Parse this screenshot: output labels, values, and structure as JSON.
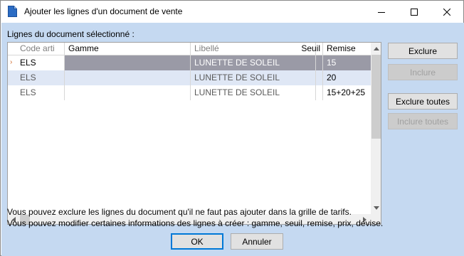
{
  "window": {
    "title": "Ajouter les lignes d'un document de vente",
    "icon": "document-icon"
  },
  "section_label": "Lignes du document sélectionné :",
  "grid": {
    "columns": [
      "Code arti",
      "Gamme",
      "Libellé",
      "Seuil",
      "Remise"
    ],
    "rows": [
      {
        "code": "ELS",
        "gamme": "",
        "libelle": "LUNETTE DE SOLEIL",
        "seuil": "",
        "remise": "15",
        "selected": true
      },
      {
        "code": "ELS",
        "gamme": "",
        "libelle": "LUNETTE DE SOLEIL",
        "seuil": "",
        "remise": "20",
        "selected": false
      },
      {
        "code": "ELS",
        "gamme": "",
        "libelle": "LUNETTE DE SOLEIL",
        "seuil": "",
        "remise": "15+20+25",
        "selected": false
      }
    ]
  },
  "buttons": {
    "exclure": "Exclure",
    "inclure": "Inclure",
    "exclure_toutes": "Exclure toutes",
    "inclure_toutes": "Inclure toutes",
    "ok": "OK",
    "annuler": "Annuler"
  },
  "info": {
    "line1": "Vous pouvez exclure les lignes du document qu'il ne faut pas ajouter dans la grille de tarifs.",
    "line2": "Vous pouvez modifier certaines informations des lignes à créer : gamme, seuil, remise, prix, devise."
  },
  "colors": {
    "background": "#c5d9f1",
    "selected_row": "#9a9aa6",
    "alt_row": "#dfe7f5"
  }
}
